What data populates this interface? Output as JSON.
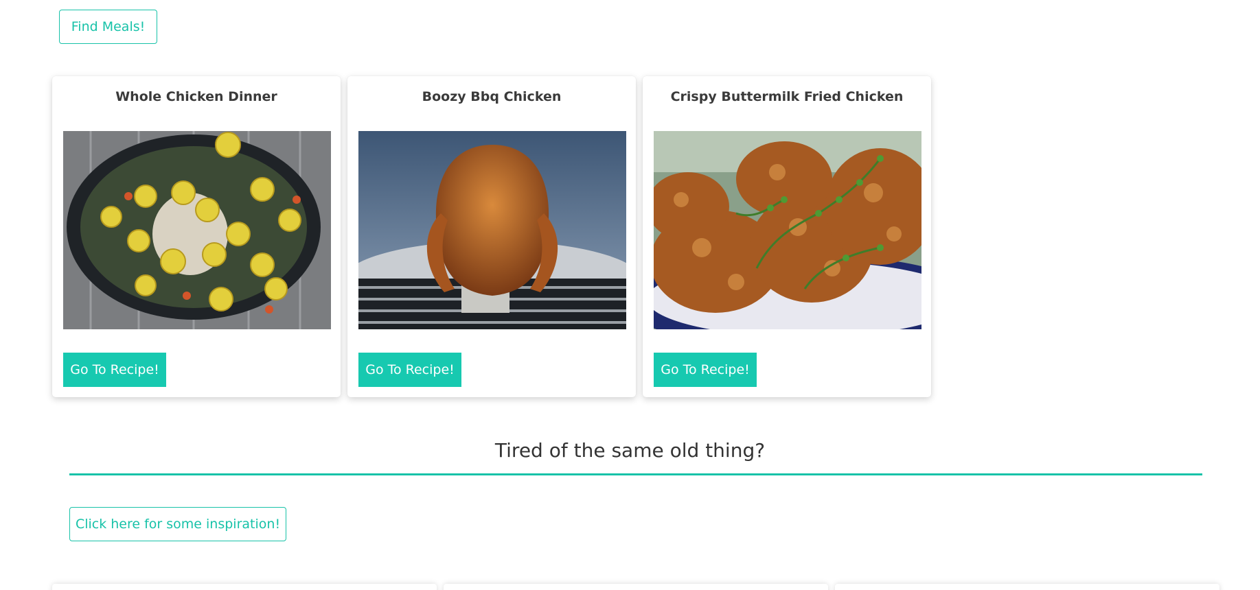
{
  "search": {
    "find_button_label": "Find Meals!"
  },
  "meals": [
    {
      "title": "Whole Chicken Dinner",
      "button_label": "Go To Recipe!"
    },
    {
      "title": "Boozy Bbq Chicken",
      "button_label": "Go To Recipe!"
    },
    {
      "title": "Crispy Buttermilk Fried Chicken",
      "button_label": "Go To Recipe!"
    }
  ],
  "inspiration": {
    "heading": "Tired of the same old thing?",
    "button_label": "Click here for some inspiration!"
  },
  "colors": {
    "accent": "#17c2a8",
    "text": "#3a3a3a"
  }
}
